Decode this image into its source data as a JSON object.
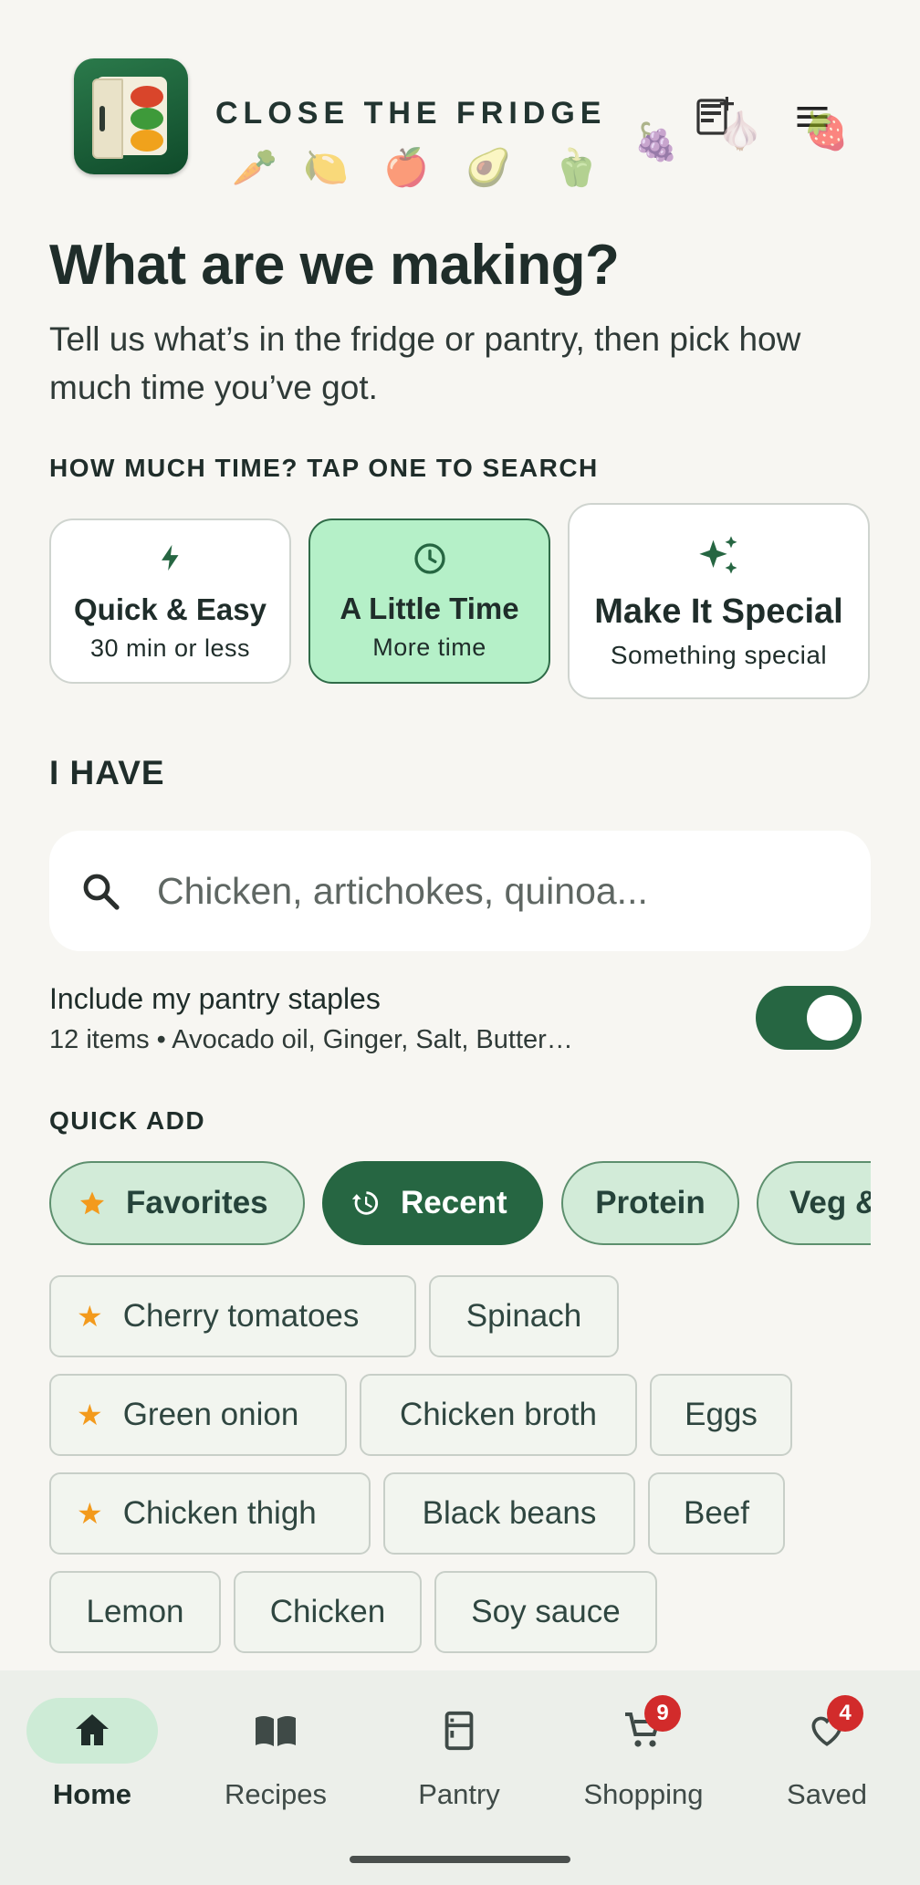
{
  "header": {
    "brand": "CLOSE THE FRIDGE",
    "produce": [
      "🥕",
      "🍋",
      "🍎",
      "🥑",
      "🫑",
      "🍇",
      "🧄",
      "🍓"
    ]
  },
  "hero": {
    "title": "What are we making?",
    "subtitle": "Tell us what’s in the fridge or pantry, then pick how much time you’ve got."
  },
  "time": {
    "label": "HOW MUCH TIME? TAP ONE TO SEARCH",
    "options": [
      {
        "label": "Quick & Easy",
        "sub": "30 min or less",
        "icon": "bolt-icon"
      },
      {
        "label": "A Little Time",
        "sub": "More time",
        "icon": "clock-icon",
        "selected": true
      },
      {
        "label": "Make It Special",
        "sub": "Something special",
        "icon": "sparkle-icon"
      }
    ]
  },
  "ingredients": {
    "label": "I HAVE",
    "placeholder": "Chicken, artichokes, quinoa...",
    "value": ""
  },
  "pantry": {
    "title": "Include my pantry staples",
    "detail": "12 items • Avocado oil, Ginger, Salt, Butter…",
    "enabled": true
  },
  "quick_add": {
    "label": "QUICK ADD",
    "filters": [
      "Favorites",
      "Recent",
      "Protein",
      "Veg &"
    ],
    "active_filter": "Recent",
    "chips": [
      {
        "label": "Cherry tomatoes",
        "favorite": true
      },
      {
        "label": "Spinach",
        "favorite": false
      },
      {
        "label": "Green onion",
        "favorite": true
      },
      {
        "label": "Chicken broth",
        "favorite": false
      },
      {
        "label": "Eggs",
        "favorite": false
      },
      {
        "label": "Chicken thigh",
        "favorite": true
      },
      {
        "label": "Black beans",
        "favorite": false
      },
      {
        "label": "Beef",
        "favorite": false
      },
      {
        "label": "Lemon",
        "favorite": false
      },
      {
        "label": "Chicken",
        "favorite": false
      },
      {
        "label": "Soy sauce",
        "favorite": false
      }
    ]
  },
  "nav": {
    "items": [
      {
        "label": "Home",
        "icon": "home-icon",
        "active": true
      },
      {
        "label": "Recipes",
        "icon": "book-icon"
      },
      {
        "label": "Pantry",
        "icon": "fridge-icon"
      },
      {
        "label": "Shopping",
        "icon": "cart-icon",
        "badge": "9"
      },
      {
        "label": "Saved",
        "icon": "heart-icon",
        "badge": "4"
      }
    ]
  },
  "colors": {
    "primary": "#266642",
    "selected_card": "#b5f0c8",
    "chip_bg": "#d2ebd8",
    "star": "#f39a1c",
    "badge": "#d22b2b",
    "background": "#f7f6f2"
  }
}
